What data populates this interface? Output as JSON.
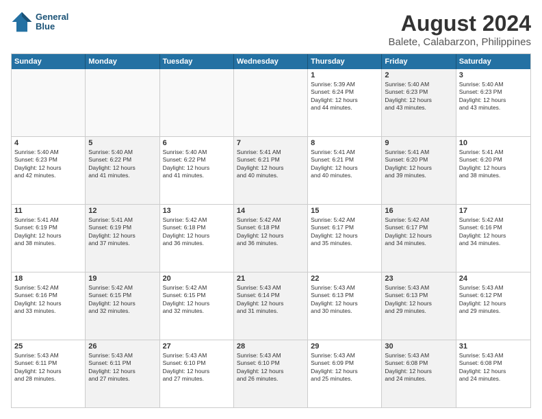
{
  "header": {
    "logo_line1": "General",
    "logo_line2": "Blue",
    "month_year": "August 2024",
    "location": "Balete, Calabarzon, Philippines"
  },
  "weekdays": [
    "Sunday",
    "Monday",
    "Tuesday",
    "Wednesday",
    "Thursday",
    "Friday",
    "Saturday"
  ],
  "rows": [
    [
      {
        "day": "",
        "text": "",
        "shaded": false,
        "empty": true
      },
      {
        "day": "",
        "text": "",
        "shaded": false,
        "empty": true
      },
      {
        "day": "",
        "text": "",
        "shaded": false,
        "empty": true
      },
      {
        "day": "",
        "text": "",
        "shaded": false,
        "empty": true
      },
      {
        "day": "1",
        "text": "Sunrise: 5:39 AM\nSunset: 6:24 PM\nDaylight: 12 hours\nand 44 minutes.",
        "shaded": false,
        "empty": false
      },
      {
        "day": "2",
        "text": "Sunrise: 5:40 AM\nSunset: 6:23 PM\nDaylight: 12 hours\nand 43 minutes.",
        "shaded": true,
        "empty": false
      },
      {
        "day": "3",
        "text": "Sunrise: 5:40 AM\nSunset: 6:23 PM\nDaylight: 12 hours\nand 43 minutes.",
        "shaded": false,
        "empty": false
      }
    ],
    [
      {
        "day": "4",
        "text": "Sunrise: 5:40 AM\nSunset: 6:23 PM\nDaylight: 12 hours\nand 42 minutes.",
        "shaded": false,
        "empty": false
      },
      {
        "day": "5",
        "text": "Sunrise: 5:40 AM\nSunset: 6:22 PM\nDaylight: 12 hours\nand 41 minutes.",
        "shaded": true,
        "empty": false
      },
      {
        "day": "6",
        "text": "Sunrise: 5:40 AM\nSunset: 6:22 PM\nDaylight: 12 hours\nand 41 minutes.",
        "shaded": false,
        "empty": false
      },
      {
        "day": "7",
        "text": "Sunrise: 5:41 AM\nSunset: 6:21 PM\nDaylight: 12 hours\nand 40 minutes.",
        "shaded": true,
        "empty": false
      },
      {
        "day": "8",
        "text": "Sunrise: 5:41 AM\nSunset: 6:21 PM\nDaylight: 12 hours\nand 40 minutes.",
        "shaded": false,
        "empty": false
      },
      {
        "day": "9",
        "text": "Sunrise: 5:41 AM\nSunset: 6:20 PM\nDaylight: 12 hours\nand 39 minutes.",
        "shaded": true,
        "empty": false
      },
      {
        "day": "10",
        "text": "Sunrise: 5:41 AM\nSunset: 6:20 PM\nDaylight: 12 hours\nand 38 minutes.",
        "shaded": false,
        "empty": false
      }
    ],
    [
      {
        "day": "11",
        "text": "Sunrise: 5:41 AM\nSunset: 6:19 PM\nDaylight: 12 hours\nand 38 minutes.",
        "shaded": false,
        "empty": false
      },
      {
        "day": "12",
        "text": "Sunrise: 5:41 AM\nSunset: 6:19 PM\nDaylight: 12 hours\nand 37 minutes.",
        "shaded": true,
        "empty": false
      },
      {
        "day": "13",
        "text": "Sunrise: 5:42 AM\nSunset: 6:18 PM\nDaylight: 12 hours\nand 36 minutes.",
        "shaded": false,
        "empty": false
      },
      {
        "day": "14",
        "text": "Sunrise: 5:42 AM\nSunset: 6:18 PM\nDaylight: 12 hours\nand 36 minutes.",
        "shaded": true,
        "empty": false
      },
      {
        "day": "15",
        "text": "Sunrise: 5:42 AM\nSunset: 6:17 PM\nDaylight: 12 hours\nand 35 minutes.",
        "shaded": false,
        "empty": false
      },
      {
        "day": "16",
        "text": "Sunrise: 5:42 AM\nSunset: 6:17 PM\nDaylight: 12 hours\nand 34 minutes.",
        "shaded": true,
        "empty": false
      },
      {
        "day": "17",
        "text": "Sunrise: 5:42 AM\nSunset: 6:16 PM\nDaylight: 12 hours\nand 34 minutes.",
        "shaded": false,
        "empty": false
      }
    ],
    [
      {
        "day": "18",
        "text": "Sunrise: 5:42 AM\nSunset: 6:16 PM\nDaylight: 12 hours\nand 33 minutes.",
        "shaded": false,
        "empty": false
      },
      {
        "day": "19",
        "text": "Sunrise: 5:42 AM\nSunset: 6:15 PM\nDaylight: 12 hours\nand 32 minutes.",
        "shaded": true,
        "empty": false
      },
      {
        "day": "20",
        "text": "Sunrise: 5:42 AM\nSunset: 6:15 PM\nDaylight: 12 hours\nand 32 minutes.",
        "shaded": false,
        "empty": false
      },
      {
        "day": "21",
        "text": "Sunrise: 5:43 AM\nSunset: 6:14 PM\nDaylight: 12 hours\nand 31 minutes.",
        "shaded": true,
        "empty": false
      },
      {
        "day": "22",
        "text": "Sunrise: 5:43 AM\nSunset: 6:13 PM\nDaylight: 12 hours\nand 30 minutes.",
        "shaded": false,
        "empty": false
      },
      {
        "day": "23",
        "text": "Sunrise: 5:43 AM\nSunset: 6:13 PM\nDaylight: 12 hours\nand 29 minutes.",
        "shaded": true,
        "empty": false
      },
      {
        "day": "24",
        "text": "Sunrise: 5:43 AM\nSunset: 6:12 PM\nDaylight: 12 hours\nand 29 minutes.",
        "shaded": false,
        "empty": false
      }
    ],
    [
      {
        "day": "25",
        "text": "Sunrise: 5:43 AM\nSunset: 6:11 PM\nDaylight: 12 hours\nand 28 minutes.",
        "shaded": false,
        "empty": false
      },
      {
        "day": "26",
        "text": "Sunrise: 5:43 AM\nSunset: 6:11 PM\nDaylight: 12 hours\nand 27 minutes.",
        "shaded": true,
        "empty": false
      },
      {
        "day": "27",
        "text": "Sunrise: 5:43 AM\nSunset: 6:10 PM\nDaylight: 12 hours\nand 27 minutes.",
        "shaded": false,
        "empty": false
      },
      {
        "day": "28",
        "text": "Sunrise: 5:43 AM\nSunset: 6:10 PM\nDaylight: 12 hours\nand 26 minutes.",
        "shaded": true,
        "empty": false
      },
      {
        "day": "29",
        "text": "Sunrise: 5:43 AM\nSunset: 6:09 PM\nDaylight: 12 hours\nand 25 minutes.",
        "shaded": false,
        "empty": false
      },
      {
        "day": "30",
        "text": "Sunrise: 5:43 AM\nSunset: 6:08 PM\nDaylight: 12 hours\nand 24 minutes.",
        "shaded": true,
        "empty": false
      },
      {
        "day": "31",
        "text": "Sunrise: 5:43 AM\nSunset: 6:08 PM\nDaylight: 12 hours\nand 24 minutes.",
        "shaded": false,
        "empty": false
      }
    ]
  ]
}
